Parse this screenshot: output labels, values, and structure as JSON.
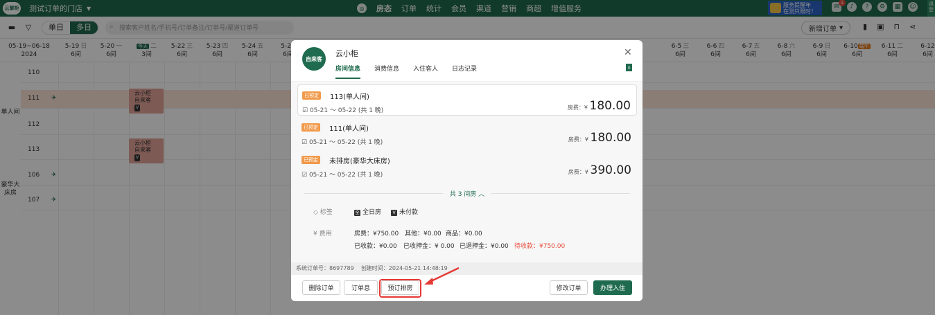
{
  "topbar": {
    "logo": "云掌柜",
    "store": "测试订单的门店",
    "nav": [
      "房态",
      "订单",
      "统计",
      "会员",
      "渠道",
      "营销",
      "商超",
      "增值服务"
    ],
    "promo_line1": "服务提醒年",
    "promo_line2": "在测只限时！",
    "badge": "1",
    "side_tab": "退登"
  },
  "toolbar": {
    "view_single": "单日",
    "view_multi": "多日",
    "search_placeholder": "搜索客户姓名/手机号/订单备注/订单号/渠道订单号",
    "new_order": "新增订单"
  },
  "calendar": {
    "range": "05-19~06-18",
    "year": "2024",
    "dates": [
      {
        "d": "5-19",
        "w": "日",
        "n": "6间"
      },
      {
        "d": "5-20",
        "w": "一",
        "n": "6间"
      },
      {
        "d": "",
        "w": "二",
        "n": "3间",
        "tag": "今天"
      },
      {
        "d": "5-22",
        "w": "三",
        "n": "6间"
      },
      {
        "d": "5-23",
        "w": "四",
        "n": "6间"
      },
      {
        "d": "5-24",
        "w": "五",
        "n": "6间"
      },
      {
        "d": "5-25",
        "w": "",
        "n": "6间"
      },
      {
        "d": "6-5",
        "w": "三",
        "n": "6间"
      },
      {
        "d": "6-6",
        "w": "四",
        "n": "6间"
      },
      {
        "d": "6-7",
        "w": "五",
        "n": "6间"
      },
      {
        "d": "6-8",
        "w": "六",
        "n": "6间"
      },
      {
        "d": "6-9",
        "w": "日",
        "n": "6间"
      },
      {
        "d": "6-10",
        "w": "",
        "n": "6间",
        "tag": "端午"
      },
      {
        "d": "6-11",
        "w": "二",
        "n": "6间"
      },
      {
        "d": "6-12",
        "w": "",
        "n": "6间"
      }
    ],
    "groups": [
      "单人间",
      "豪华大床房"
    ],
    "rooms": [
      "110",
      "111",
      "112",
      "113",
      "106",
      "107"
    ],
    "booking_line1": "云小柜",
    "booking_line2": "自来客",
    "booking_tag": "V"
  },
  "modal": {
    "avatar": "自来客",
    "name": "云小柜",
    "tabs": [
      "房间信息",
      "消费信息",
      "入住客人",
      "日志记录"
    ],
    "rooms": [
      {
        "status": "已预定",
        "room": "113(单人间)",
        "dates": "05-21 ～ 05-22 (共 1 晚)",
        "fee_label": "房费：¥",
        "fee": "180.00"
      },
      {
        "status": "已预定",
        "room": "111(单人间)",
        "dates": "05-21 ～ 05-22 (共 1 晚)",
        "fee_label": "房费：¥",
        "fee": "180.00"
      },
      {
        "status": "已预定",
        "room": "未排房(豪华大床房)",
        "dates": "05-21 ～ 05-22 (共 1 晚)",
        "fee_label": "房费：¥",
        "fee": "390.00"
      }
    ],
    "total_rooms": "共 3 间房 ︿",
    "tag_label": "标签",
    "tag1": "全日房",
    "tag2": "未付款",
    "fee_label": "费用",
    "fee_line1": [
      "房费：¥750.00",
      "其他：¥0.00",
      "商品：¥0.00"
    ],
    "fee_line2": [
      "已收款：¥0.00",
      "已收押金：¥ 0.00",
      "已退押金：¥0.00"
    ],
    "pending": "待收款：¥750.00",
    "order_no": "系统订单号：8697789",
    "created": "创建时间：2024-05-21 14:48:19",
    "buttons": {
      "delete": "删除订单",
      "slip": "订单息",
      "assign": "预订排房",
      "edit": "修改订单",
      "checkin": "办理入住"
    }
  }
}
